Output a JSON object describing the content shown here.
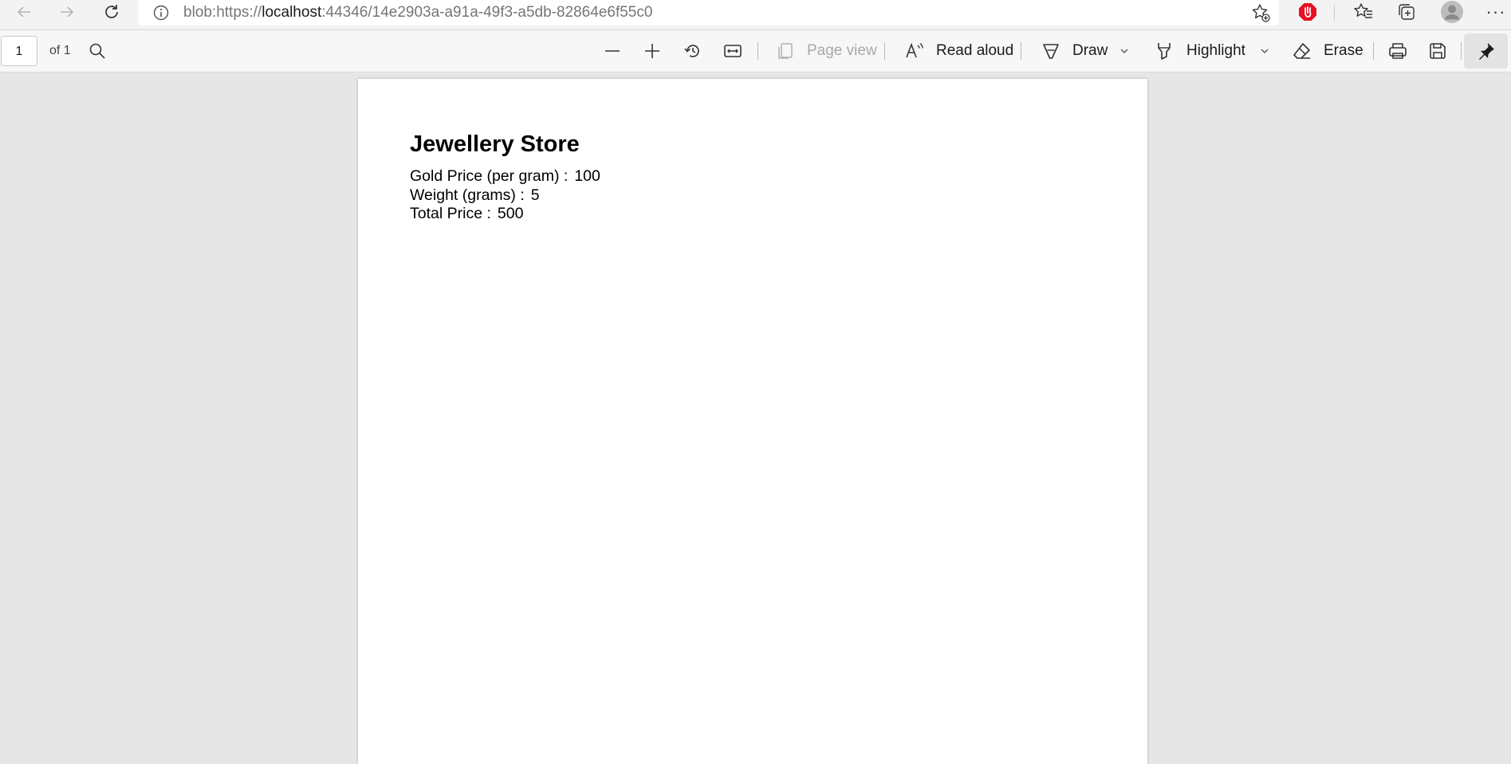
{
  "browser": {
    "url_prefix": "blob:https://",
    "url_host": "localhost",
    "url_rest": ":44346/14e2903a-a91a-49f3-a5db-82864e6f55c0",
    "more_label": "···"
  },
  "pdf_toolbar": {
    "page_number": "1",
    "page_of": "of 1",
    "page_view_label": "Page view",
    "read_aloud_label": "Read aloud",
    "draw_label": "Draw",
    "highlight_label": "Highlight",
    "erase_label": "Erase"
  },
  "document": {
    "title": "Jewellery Store",
    "lines": [
      {
        "label": "Gold Price (per gram) :",
        "value": "100"
      },
      {
        "label": "Weight (grams) :",
        "value": "5"
      },
      {
        "label": "Total Price :",
        "value": "500"
      }
    ]
  },
  "colors": {
    "extension_red": "#e81123",
    "toolbar_bg": "#f7f7f7",
    "viewer_bg": "#e6e6e6"
  },
  "icons": [
    "back-icon",
    "forward-icon",
    "refresh-icon",
    "info-icon",
    "add-favorite-icon",
    "extension-stop-icon",
    "favorites-icon",
    "collections-icon",
    "profile-icon",
    "more-icon",
    "search-icon",
    "zoom-out-icon",
    "zoom-in-icon",
    "rotate-icon",
    "fit-width-icon",
    "page-view-icon",
    "read-aloud-icon",
    "draw-icon",
    "chevron-down-icon",
    "highlight-icon",
    "erase-icon",
    "print-icon",
    "save-icon",
    "pin-icon"
  ]
}
